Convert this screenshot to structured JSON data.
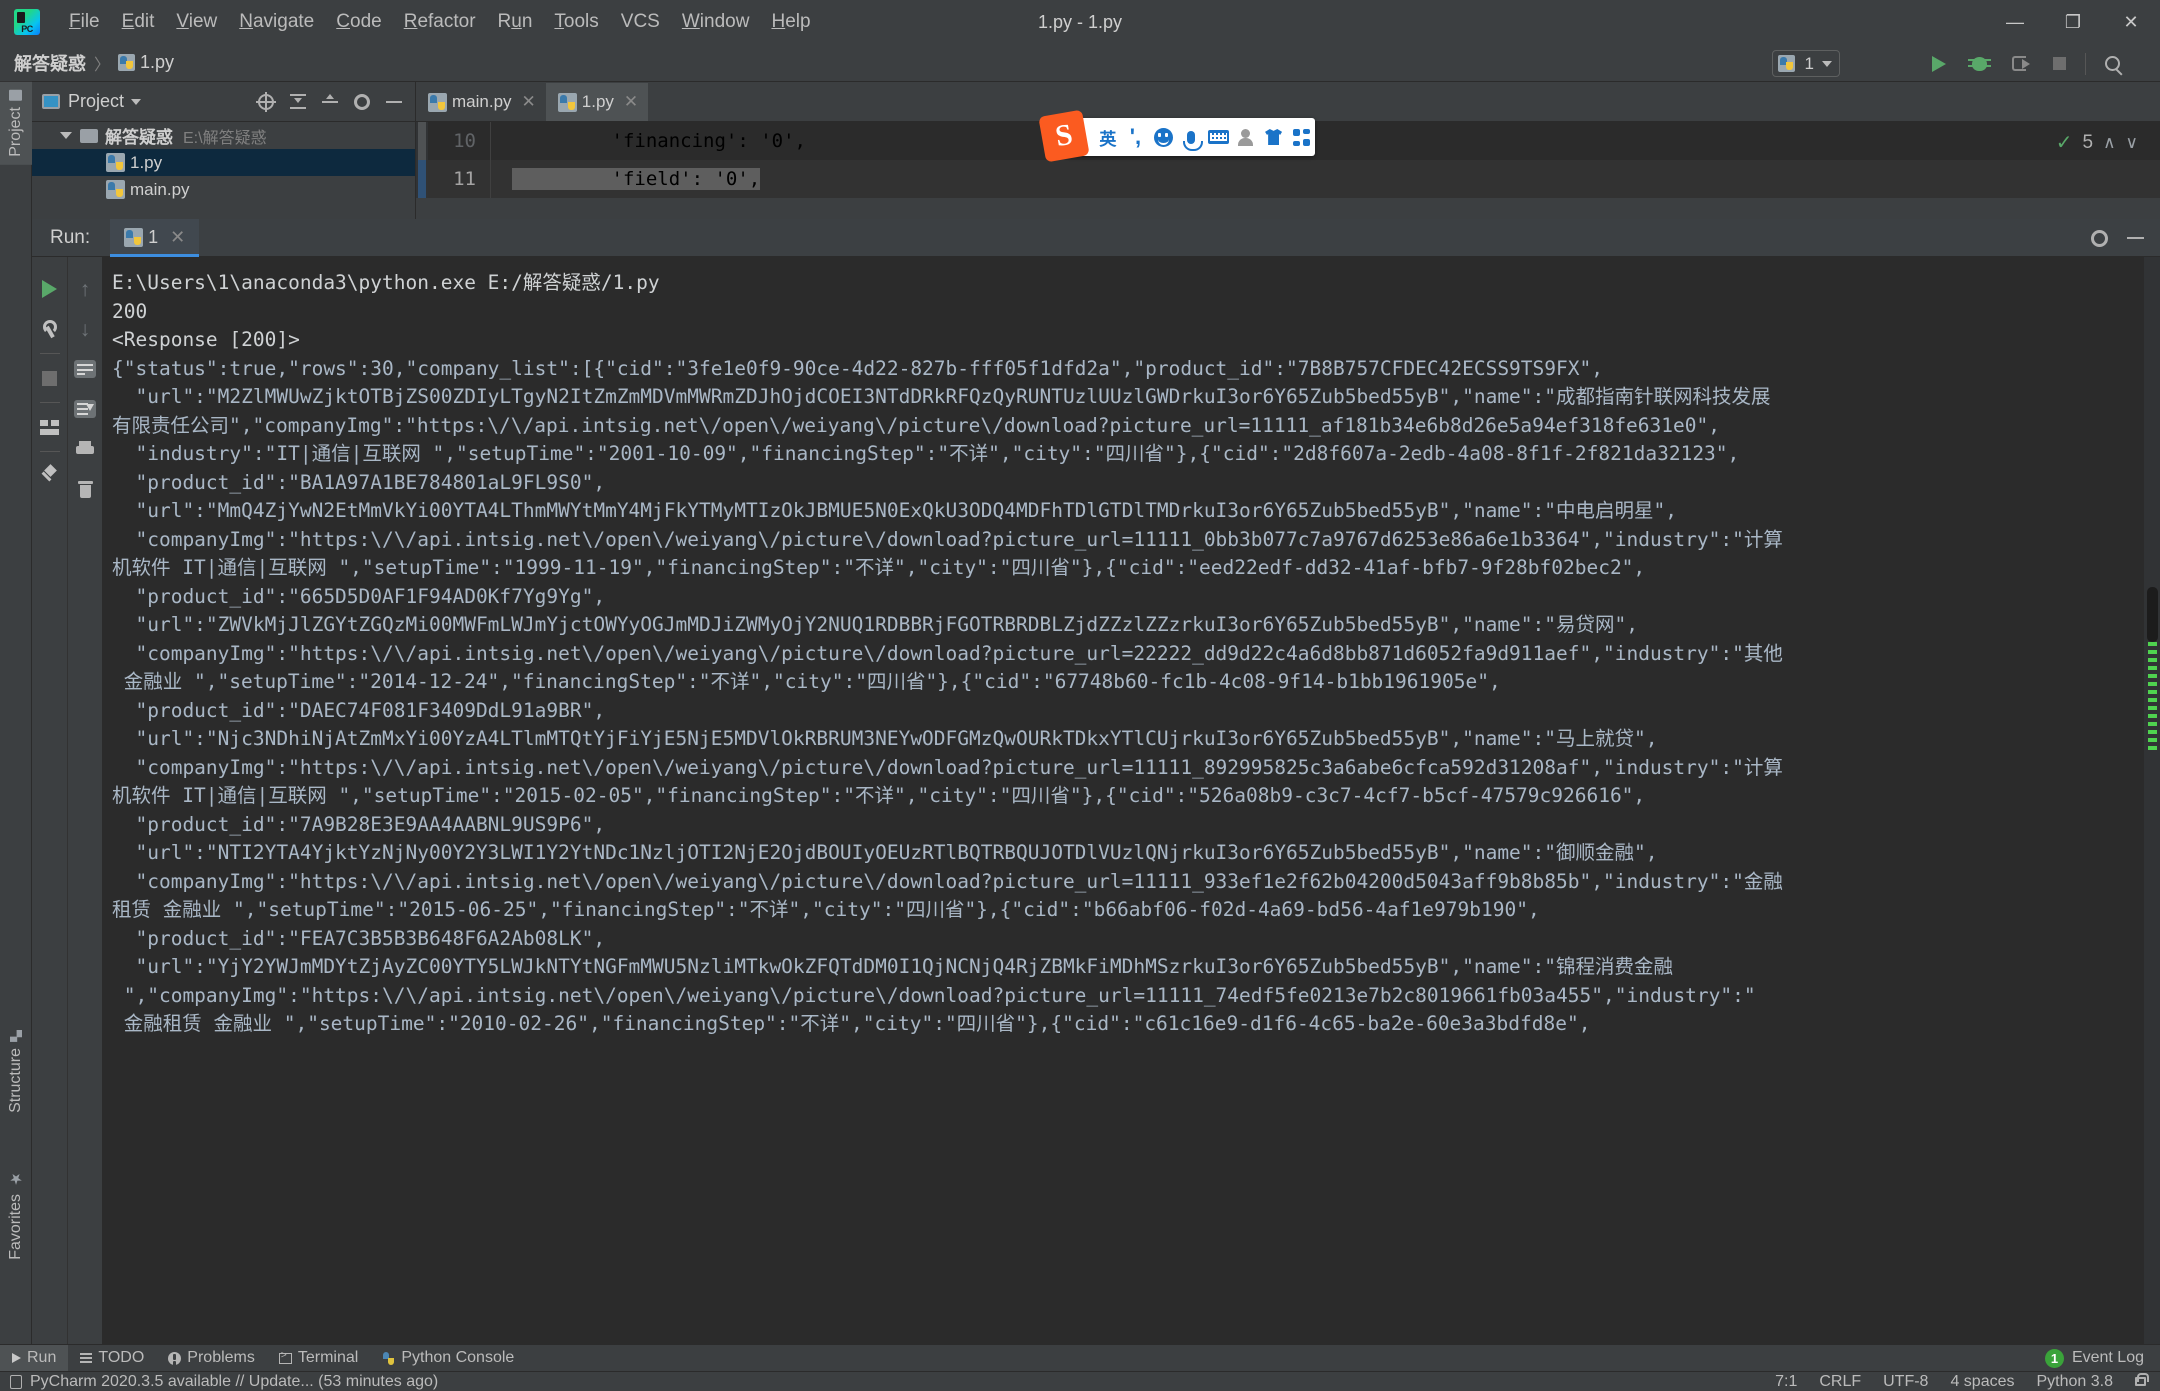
{
  "window": {
    "title": "1.py - 1.py",
    "minimize_label": "—",
    "restore_label": "❐",
    "close_label": "✕"
  },
  "menubar": {
    "items": [
      {
        "label": "File",
        "mnemonic": "F"
      },
      {
        "label": "Edit",
        "mnemonic": "E"
      },
      {
        "label": "View",
        "mnemonic": "V"
      },
      {
        "label": "Navigate",
        "mnemonic": "N"
      },
      {
        "label": "Code",
        "mnemonic": "C"
      },
      {
        "label": "Refactor",
        "mnemonic": "R"
      },
      {
        "label": "Run",
        "mnemonic": "u"
      },
      {
        "label": "Tools",
        "mnemonic": "T"
      },
      {
        "label": "VCS",
        "mnemonic": ""
      },
      {
        "label": "Window",
        "mnemonic": "W"
      },
      {
        "label": "Help",
        "mnemonic": "H"
      }
    ]
  },
  "breadcrumb": {
    "project": "解答疑惑",
    "separator": "〉",
    "file": "1.py"
  },
  "run_config": {
    "name": "1",
    "run_label": "Run",
    "debug_label": "Debug",
    "run_with_coverage_label": "Run with Coverage",
    "stop_label": "Stop",
    "search_label": "Search Everywhere"
  },
  "tool_strip_left": {
    "project_tab": "Project",
    "structure_tab": "Structure",
    "favorites_tab": "Favorites"
  },
  "project_panel": {
    "title": "Project",
    "tree": [
      {
        "label": "解答疑惑",
        "path": "E:\\解答疑惑",
        "type": "folder",
        "expanded": true,
        "selected": false
      },
      {
        "label": "1.py",
        "path": "",
        "type": "python",
        "expanded": false,
        "selected": true
      },
      {
        "label": "main.py",
        "path": "",
        "type": "python",
        "expanded": false,
        "selected": false
      }
    ]
  },
  "editor": {
    "tabs": [
      {
        "label": "main.py",
        "active": false,
        "close": "✕"
      },
      {
        "label": "1.py",
        "active": true,
        "close": "✕"
      }
    ],
    "lines": [
      {
        "number": "10",
        "text": "        'financing': '0',",
        "current": false
      },
      {
        "number": "11",
        "text": "        'field': '0',",
        "current": true
      }
    ],
    "inspection_count": "5",
    "inspection_up": "∧",
    "inspection_down": "∨"
  },
  "ime_bar": {
    "logo": "S",
    "mode_label": "英",
    "items": [
      "english-mode",
      "comma-punctuation",
      "emoji",
      "voice-input",
      "soft-keyboard",
      "user-profile",
      "skin",
      "app-grid"
    ]
  },
  "run_panel": {
    "title": "Run:",
    "tab_label": "1",
    "tab_close": "✕",
    "side_buttons": [
      "rerun",
      "settings-wrench",
      "stop",
      "layout",
      "pin",
      "scroll-up",
      "scroll-down",
      "soft-wrap",
      "scroll-to-end",
      "print",
      "clear-all"
    ],
    "console_lines": [
      "E:\\Users\\1\\anaconda3\\python.exe E:/解答疑惑/1.py",
      "200",
      "<Response [200]>",
      "{\"status\":true,\"rows\":30,\"company_list\":[{\"cid\":\"3fe1e0f9-90ce-4d22-827b-fff05f1dfd2a\",\"product_id\":\"7B8B757CFDEC42ECSS9TS9FX\",",
      "  \"url\":\"M2ZlMWUwZjktOTBjZS00ZDIyLTgyN2ItZmZmMDVmMWRmZDJhOjdCOEI3NTdDRkRFQzQyRUNTUzlUUzlGWDrkuI3or6Y65Zub5bed55yB\",\"name\":\"成都指南针联网科技发展",
      "有限责任公司\",\"companyImg\":\"https:\\/\\/api.intsig.net\\/open\\/weiyang\\/picture\\/download?picture_url=11111_af181b34e6b8d26e5a94ef318fe631e0\",",
      "  \"industry\":\"IT|通信|互联网 \",\"setupTime\":\"2001-10-09\",\"financingStep\":\"不详\",\"city\":\"四川省\"},{\"cid\":\"2d8f607a-2edb-4a08-8f1f-2f821da32123\",",
      "  \"product_id\":\"BA1A97A1BE784801aL9FL9S0\",",
      "  \"url\":\"MmQ4ZjYwN2EtMmVkYi00YTA4LThmMWYtMmY4MjFkYTMyMTIzOkJBMUE5N0ExQkU3ODQ4MDFhTDlGTDlTMDrkuI3or6Y65Zub5bed55yB\",\"name\":\"中电启明星\",",
      "  \"companyImg\":\"https:\\/\\/api.intsig.net\\/open\\/weiyang\\/picture\\/download?picture_url=11111_0bb3b077c7a9767d6253e86a6e1b3364\",\"industry\":\"计算",
      "机软件 IT|通信|互联网 \",\"setupTime\":\"1999-11-19\",\"financingStep\":\"不详\",\"city\":\"四川省\"},{\"cid\":\"eed22edf-dd32-41af-bfb7-9f28bf02bec2\",",
      "  \"product_id\":\"665D5D0AF1F94AD0Kf7Yg9Yg\",",
      "  \"url\":\"ZWVkMjJlZGYtZGQzMi00MWFmLWJmYjctOWYyOGJmMDJiZWMyOjY2NUQ1RDBBRjFGOTRBRDBLZjdZZzlZZzrkuI3or6Y65Zub5bed55yB\",\"name\":\"易贷网\",",
      "  \"companyImg\":\"https:\\/\\/api.intsig.net\\/open\\/weiyang\\/picture\\/download?picture_url=22222_dd9d22c4a6d8bb871d6052fa9d911aef\",\"industry\":\"其他",
      " 金融业 \",\"setupTime\":\"2014-12-24\",\"financingStep\":\"不详\",\"city\":\"四川省\"},{\"cid\":\"67748b60-fc1b-4c08-9f14-b1bb1961905e\",",
      "  \"product_id\":\"DAEC74F081F3409DdL91a9BR\",",
      "  \"url\":\"Njc3NDhiNjAtZmMxYi00YzA4LTlmMTQtYjFiYjE5NjE5MDVlOkRBRUM3NEYwODFGMzQwOURkTDkxYTlCUjrkuI3or6Y65Zub5bed55yB\",\"name\":\"马上就贷\",",
      "  \"companyImg\":\"https:\\/\\/api.intsig.net\\/open\\/weiyang\\/picture\\/download?picture_url=11111_892995825c3a6abe6cfca592d31208af\",\"industry\":\"计算",
      "机软件 IT|通信|互联网 \",\"setupTime\":\"2015-02-05\",\"financingStep\":\"不详\",\"city\":\"四川省\"},{\"cid\":\"526a08b9-c3c7-4cf7-b5cf-47579c926616\",",
      "  \"product_id\":\"7A9B28E3E9AA4AABNL9US9P6\",",
      "  \"url\":\"NTI2YTA4YjktYzNjNy00Y2Y3LWI1Y2YtNDc1NzljOTI2NjE2OjdBOUIyOEUzRTlBQTRBQUJOTDlVUzlQNjrkuI3or6Y65Zub5bed55yB\",\"name\":\"御顺金融\",",
      "  \"companyImg\":\"https:\\/\\/api.intsig.net\\/open\\/weiyang\\/picture\\/download?picture_url=11111_933ef1e2f62b04200d5043aff9b8b85b\",\"industry\":\"金融",
      "租赁 金融业 \",\"setupTime\":\"2015-06-25\",\"financingStep\":\"不详\",\"city\":\"四川省\"},{\"cid\":\"b66abf06-f02d-4a69-bd56-4af1e979b190\",",
      "  \"product_id\":\"FEA7C3B5B3B648F6A2Ab08LK\",",
      "  \"url\":\"YjY2YWJmMDYtZjAyZC00YTY5LWJkNTYtNGFmMWU5NzliMTkwOkZFQTdDM0I1QjNCNjQ4RjZBMkFiMDhMSzrkuI3or6Y65Zub5bed55yB\",\"name\":\"锦程消费金融",
      " \",\"companyImg\":\"https:\\/\\/api.intsig.net\\/open\\/weiyang\\/picture\\/download?picture_url=11111_74edf5fe0213e7b2c8019661fb03a455\",\"industry\":\"",
      " 金融租赁 金融业 \",\"setupTime\":\"2010-02-26\",\"financingStep\":\"不详\",\"city\":\"四川省\"},{\"cid\":\"c61c16e9-d1f6-4c65-ba2e-60e3a3bdfd8e\","
    ]
  },
  "bottom_tools": [
    {
      "label": "Run",
      "icon": "play-icon",
      "active": true
    },
    {
      "label": "TODO",
      "icon": "todo-icon",
      "active": false
    },
    {
      "label": "Problems",
      "icon": "problems-icon",
      "active": false
    },
    {
      "label": "Terminal",
      "icon": "terminal-icon",
      "active": false
    },
    {
      "label": "Python Console",
      "icon": "python-console-icon",
      "active": false
    }
  ],
  "event_log": {
    "badge": "1",
    "label": "Event Log"
  },
  "status_bar": {
    "message": "PyCharm 2020.3.5 available // Update... (53 minutes ago)",
    "caret": "7:1",
    "line_sep": "CRLF",
    "encoding": "UTF-8",
    "indent": "4 spaces",
    "interpreter": "Python 3.8",
    "lock": "read-write"
  },
  "colors": {
    "ide_bg": "#3c3f41",
    "editor_bg": "#2b2b2b",
    "accent_blue": "#3d8ee0",
    "selection": "#0d293e",
    "green": "#59a869",
    "string_green": "#6a8759",
    "comma_orange": "#cc7832",
    "text": "#a9b7c6",
    "sogou_orange": "#fb5b20",
    "sogou_blue": "#1a73c8"
  }
}
